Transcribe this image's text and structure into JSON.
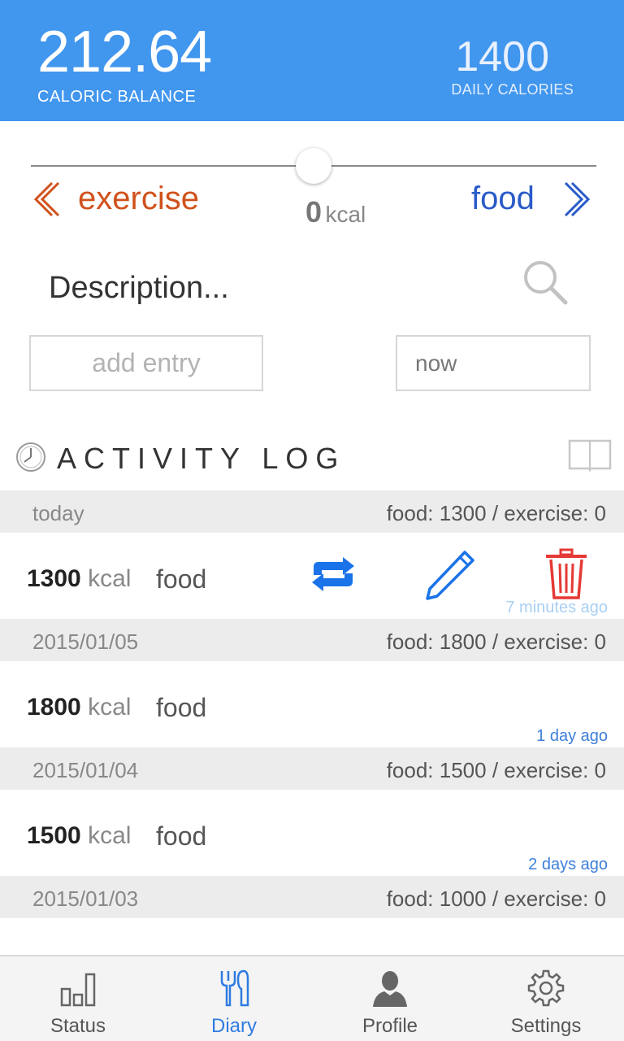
{
  "header": {
    "balance_value": "212.64",
    "balance_label": "CALORIC BALANCE",
    "daily_value": "1400",
    "daily_label": "DAILY CALORIES"
  },
  "entry_form": {
    "left_label": "exercise",
    "right_label": "food",
    "kcal_value": "0",
    "kcal_unit": "kcal",
    "slider_position": 0.5,
    "description_placeholder": "Description...",
    "add_entry_label": "add entry",
    "time_value": "now"
  },
  "activity_log": {
    "title": "ACTIVITY LOG",
    "days": [
      {
        "date": "today",
        "summary": "food: 1300 / exercise: 0",
        "entry": {
          "kcal": "1300",
          "unit": "kcal",
          "type": "food",
          "time": "7 minutes ago"
        }
      },
      {
        "date": "2015/01/05",
        "summary": "food: 1800 / exercise: 0",
        "entry": {
          "kcal": "1800",
          "unit": "kcal",
          "type": "food",
          "time": "1 day ago"
        }
      },
      {
        "date": "2015/01/04",
        "summary": "food: 1500 / exercise: 0",
        "entry": {
          "kcal": "1500",
          "unit": "kcal",
          "type": "food",
          "time": "2 days ago"
        }
      },
      {
        "date": "2015/01/03",
        "summary": "food: 1000 / exercise: 0"
      }
    ]
  },
  "tabs": [
    {
      "label": "Status",
      "icon": "bar-chart-icon"
    },
    {
      "label": "Diary",
      "icon": "fork-knife-icon",
      "active": true
    },
    {
      "label": "Profile",
      "icon": "person-icon"
    },
    {
      "label": "Settings",
      "icon": "gear-icon"
    }
  ],
  "colors": {
    "header_bg": "#4196ee",
    "exercise": "#d0521c",
    "food": "#2a5bc8",
    "accent": "#2f7be0",
    "delete": "#e53935"
  }
}
